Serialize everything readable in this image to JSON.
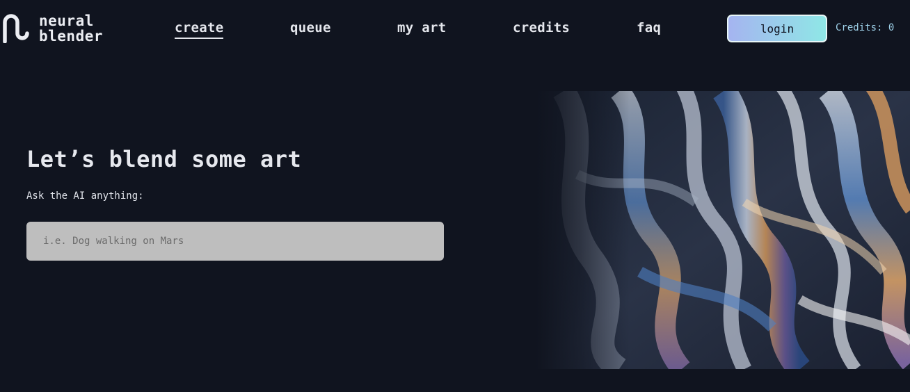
{
  "header": {
    "logo": {
      "line1": "neural",
      "line2": "blender",
      "icon": "wave-logo-icon"
    },
    "nav": [
      {
        "label": "create",
        "active": true
      },
      {
        "label": "queue",
        "active": false
      },
      {
        "label": "my art",
        "active": false
      },
      {
        "label": "credits",
        "active": false
      },
      {
        "label": "faq",
        "active": false
      }
    ],
    "login_label": "login",
    "credits_label": "Credits: 0"
  },
  "hero": {
    "title": "Let’s blend some art",
    "prompt_label": "Ask the AI anything:",
    "prompt_placeholder": "i.e. Dog walking on Mars",
    "prompt_value": ""
  },
  "colors": {
    "background": "#10141f",
    "login_gradient_start": "#a5b4f0",
    "login_gradient_end": "#8fe7e6",
    "credits_text": "#9fd2ea",
    "input_background": "#bebebe"
  }
}
